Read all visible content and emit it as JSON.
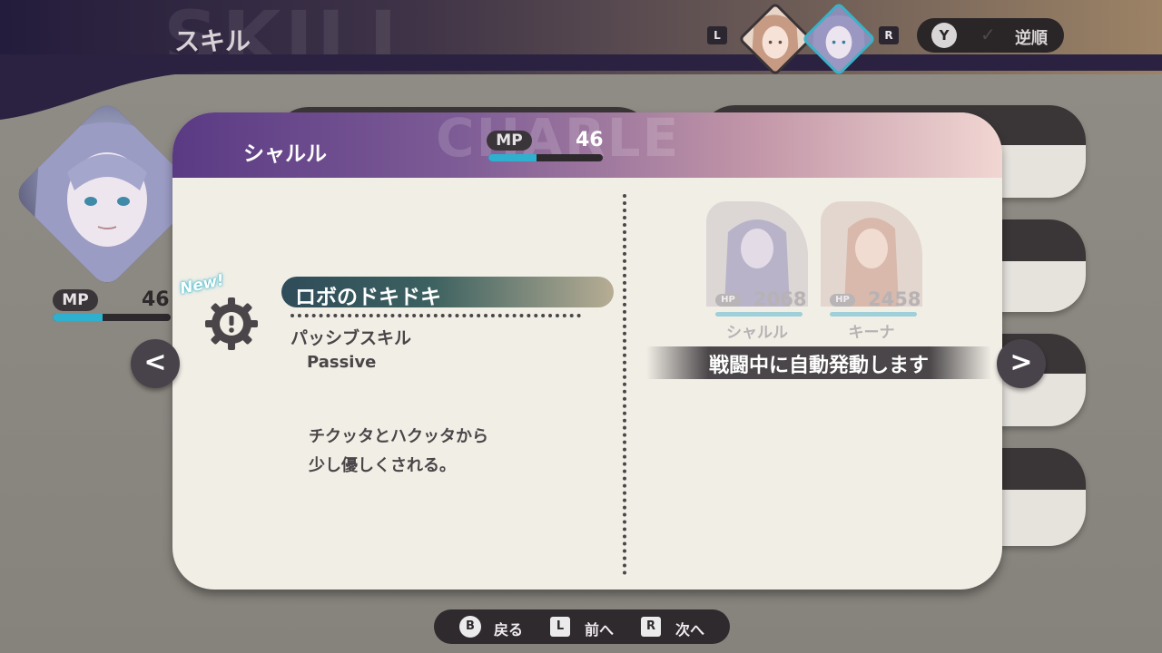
{
  "header": {
    "watermark": "SKILL",
    "title": "スキル",
    "left_shoulder": "L",
    "right_shoulder": "R",
    "order_button": "Y",
    "order_label": "逆順"
  },
  "sidebar_character": {
    "mp_label": "MP",
    "mp_value": "46",
    "mp_fraction": 0.42
  },
  "panel": {
    "watermark": "CHARLE",
    "character_name": "シャルル",
    "mp_label": "MP",
    "mp_value": "46",
    "mp_fraction": 0.42,
    "skill": {
      "new_badge": "New!",
      "name": "ロボのドキドキ",
      "type": "パッシブスキル",
      "type_en": "Passive",
      "description_lines": [
        "チクッタとハクッタから",
        "少し優しくされる。"
      ]
    },
    "targets": [
      {
        "hp_label": "HP",
        "hp_value": "2068",
        "name": "シャルル"
      },
      {
        "hp_label": "HP",
        "hp_value": "2458",
        "name": "キーナ"
      }
    ],
    "activation": "戦闘中に自動発動します"
  },
  "navigation": {
    "prev_glyph": "<",
    "next_glyph": ">"
  },
  "footer": {
    "back_button": "B",
    "back_label": "戻る",
    "prev_button": "L",
    "prev_label": "前へ",
    "next_button": "R",
    "next_label": "次へ"
  },
  "colors": {
    "mp_fill": "#2fb0cf",
    "header_purple": "#5a3a84",
    "panel_bg": "#f1eee6"
  }
}
